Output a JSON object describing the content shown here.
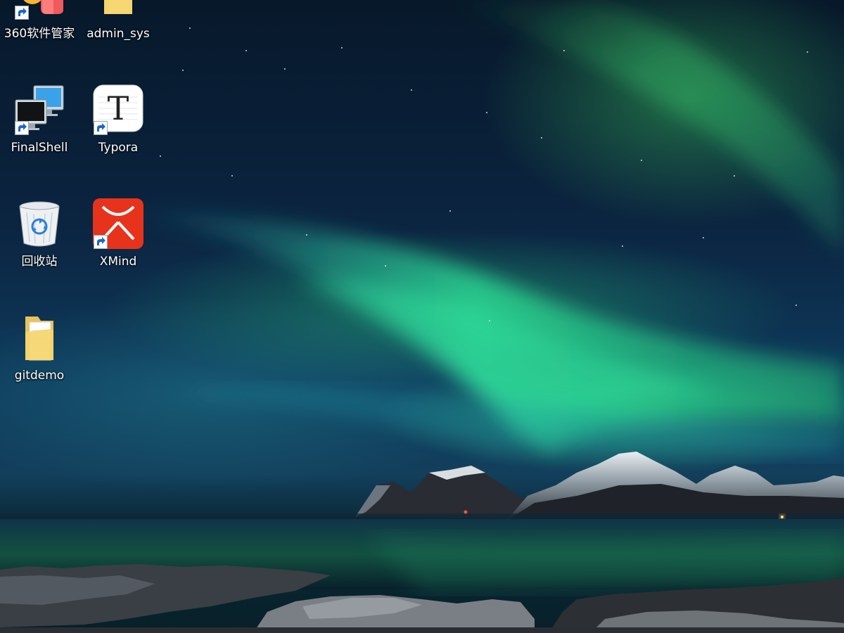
{
  "desktop": {
    "icons": [
      {
        "label": "360软件管家",
        "icon": "360-software-manager-icon",
        "shortcut": true
      },
      {
        "label": "admin_sys",
        "icon": "folder-icon",
        "shortcut": false
      },
      {
        "label": "FinalShell",
        "icon": "computer-monitors-icon",
        "shortcut": true
      },
      {
        "label": "Typora",
        "icon": "typora-t-icon",
        "shortcut": true
      },
      {
        "label": "回收站",
        "icon": "recycle-bin-icon",
        "shortcut": false
      },
      {
        "label": "XMind",
        "icon": "xmind-icon",
        "shortcut": true
      },
      {
        "label": "gitdemo",
        "icon": "folder-icon",
        "shortcut": false
      }
    ]
  },
  "colors": {
    "sky_top": "#07182a",
    "aurora_green": "#2fe39a",
    "sea": "#0c2a3a",
    "xmind_red": "#e8331c",
    "folder_yellow": "#f5d56b"
  }
}
